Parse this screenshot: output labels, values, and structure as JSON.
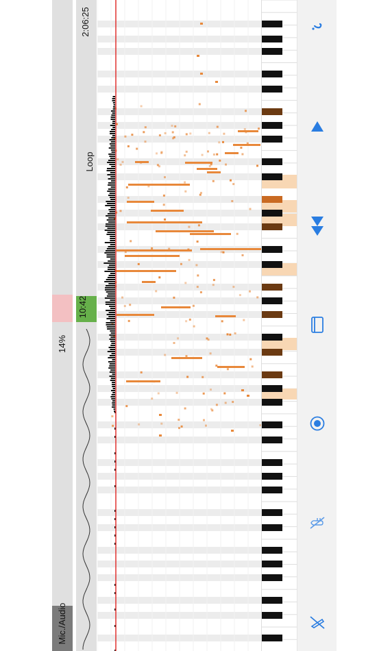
{
  "status": {
    "elapsed_time": "2:06:25",
    "loop_label": "Loop",
    "loop_time": "10:42",
    "percent": "14%",
    "source_label": "Mic./Audio"
  },
  "colors": {
    "accent": "#2a7de1",
    "note_orange": "#e8883a",
    "playhead": "#e0302e",
    "loop_green": "#66b04a",
    "loop_red": "#f3c0c2",
    "key_highlight": "#f8d7b4"
  },
  "toolbar": [
    {
      "name": "help-button",
      "icon": "question-icon"
    },
    {
      "name": "scroll-up-button",
      "icon": "triangle-up-icon"
    },
    {
      "name": "scroll-down-button",
      "icon": "double-triangle-down-icon"
    },
    {
      "name": "book-button",
      "icon": "book-icon"
    },
    {
      "name": "record-button",
      "icon": "record-icon"
    },
    {
      "name": "hand-mute-button",
      "icon": "hand-off-icon"
    },
    {
      "name": "pedal-mute-button",
      "icon": "pedal-off-icon"
    }
  ]
}
